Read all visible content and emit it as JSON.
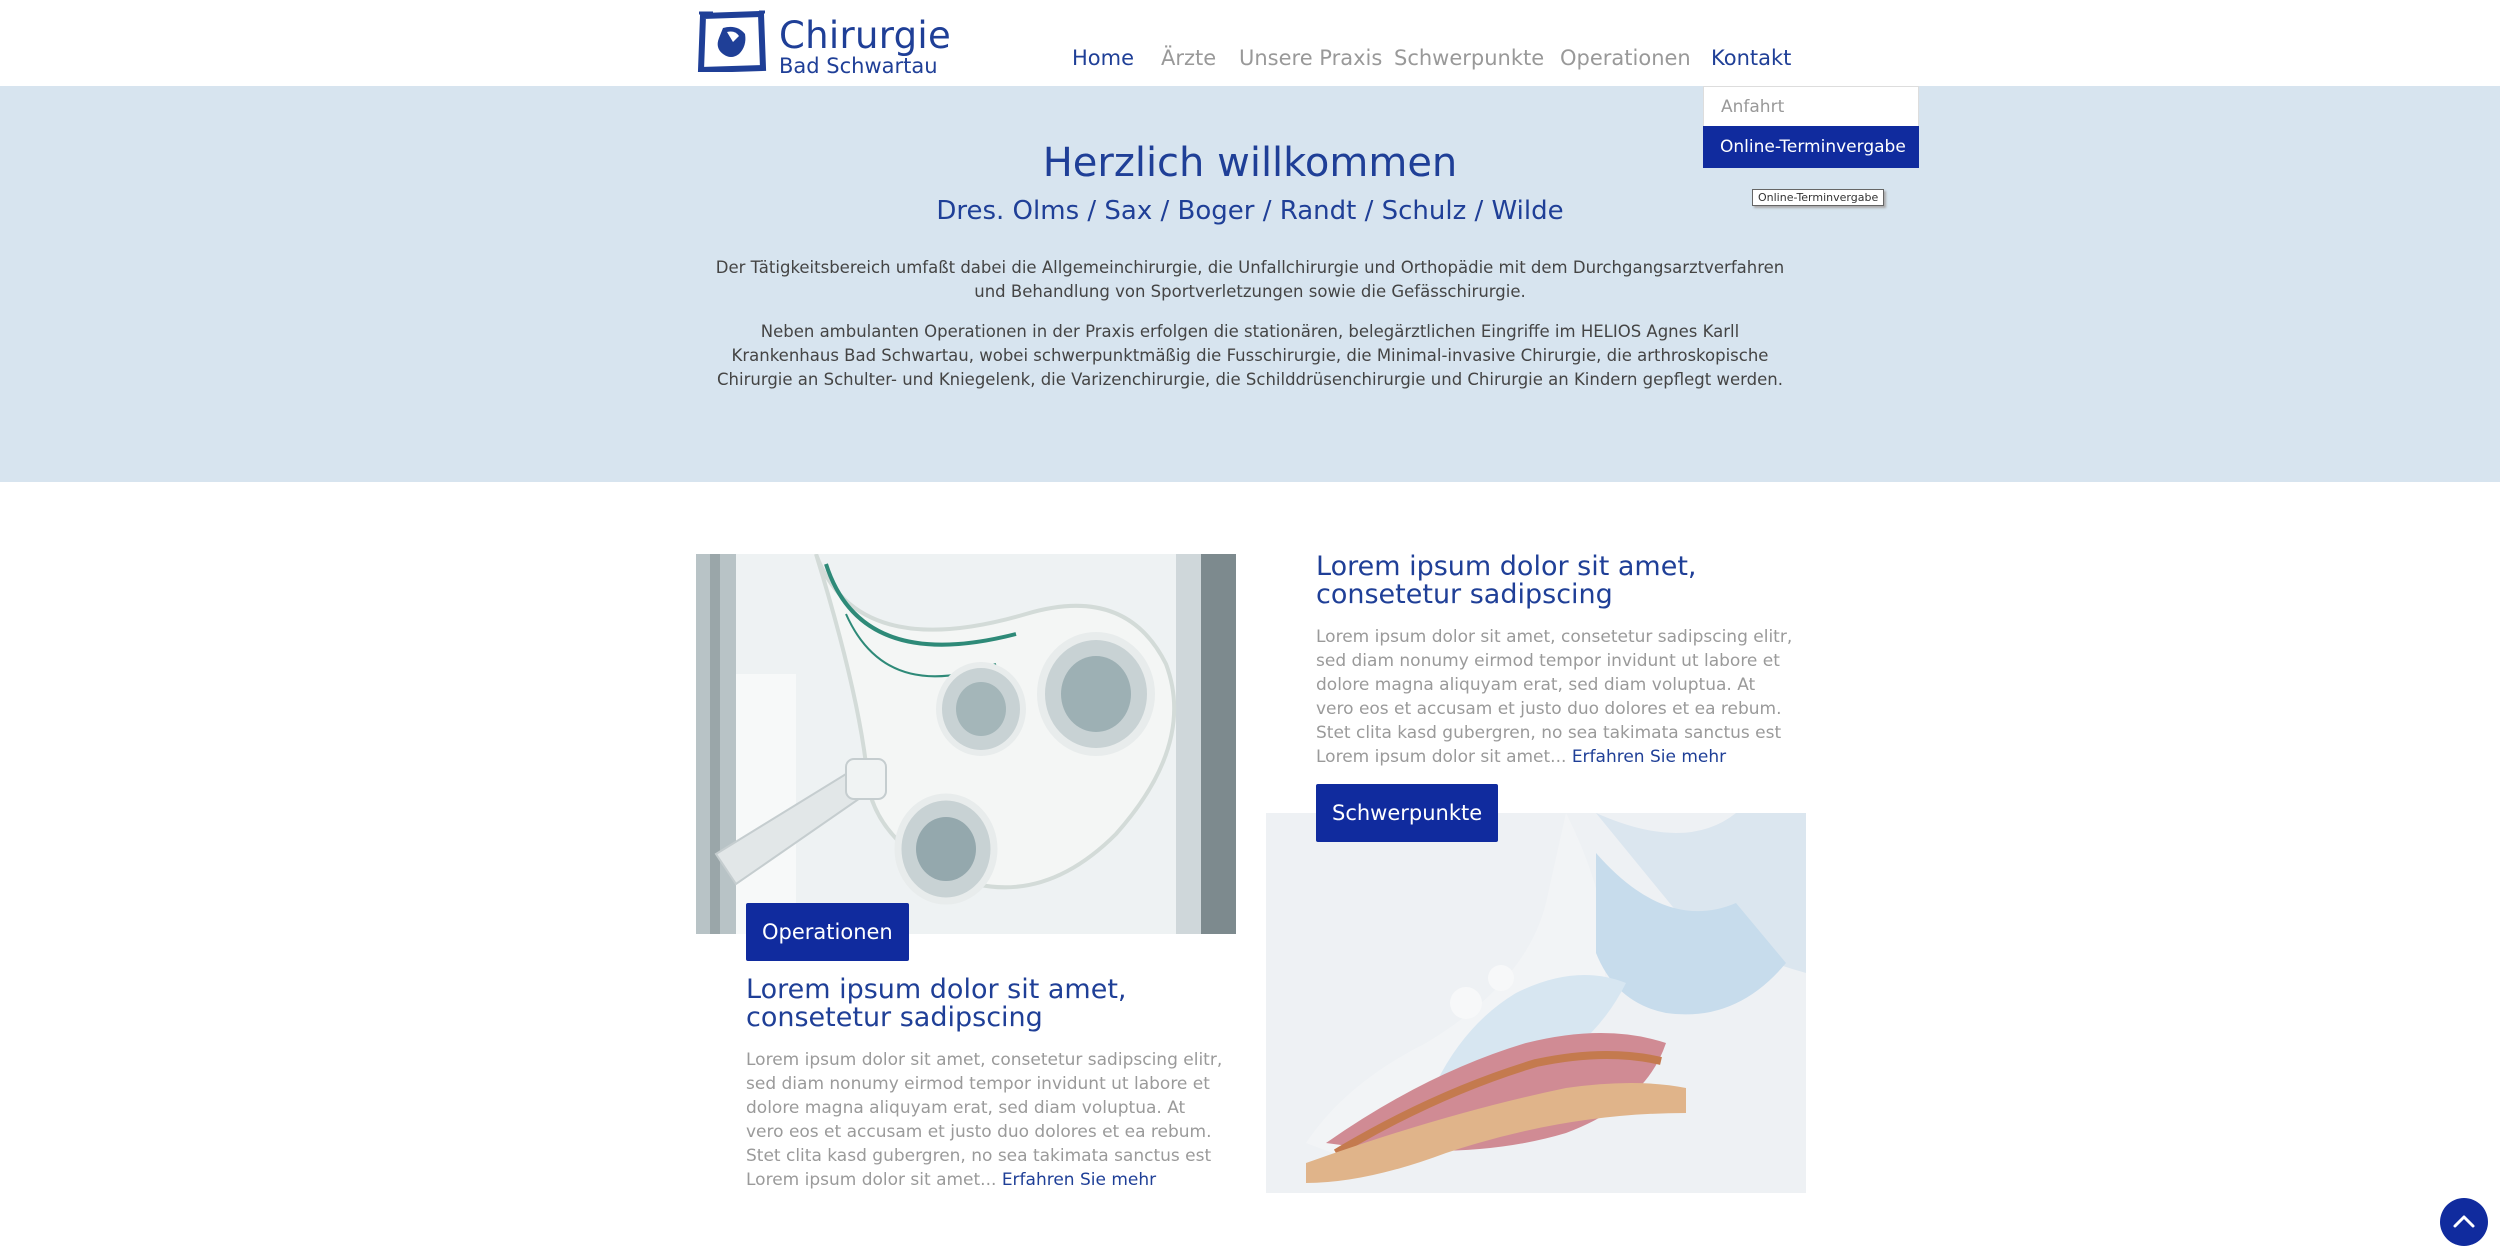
{
  "header": {
    "logo_title": "Chirurgie",
    "logo_subtitle": "Bad Schwartau"
  },
  "nav": {
    "items": [
      {
        "label": "Home",
        "active": true
      },
      {
        "label": "Ärzte"
      },
      {
        "label": "Unsere Praxis"
      },
      {
        "label": "Schwerpunkte"
      },
      {
        "label": "Operationen"
      },
      {
        "label": "Kontakt"
      }
    ],
    "dropdown": {
      "items": [
        "Anfahrt",
        "Online-Terminvergabe"
      ],
      "tooltip": "Online-Terminvergabe"
    }
  },
  "hero": {
    "title": "Herzlich willkommen",
    "subtitle": "Dres. Olms / Sax / Boger / Randt / Schulz / Wilde",
    "p1": "Der Tätigkeitsbereich umfaßt dabei die Allgemeinchirurgie, die Unfallchirurgie und Orthopädie mit dem Durchgangsarztverfahren und Behandlung von Sportverletzungen sowie die Gefässchirurgie.",
    "p2": "Neben ambulanten Operationen in der Praxis erfolgen die stationären, belegärztlichen Eingriffe im HELIOS Agnes Karll Krankenhaus Bad Schwartau, wobei schwerpunktmäßig die Fusschirurgie, die Minimal-invasive Chirurgie, die arthroskopische Chirurgie an Schulter- und Kniegelenk, die Varizenchirurgie, die Schilddrüsenchirurgie und Chirurgie an Kindern gepflegt werden."
  },
  "cards": [
    {
      "tag": "Operationen",
      "title": "Lorem ipsum dolor sit amet, consetetur sadipscing",
      "text": "Lorem ipsum dolor sit amet, consetetur sadipscing elitr, sed diam nonumy eirmod tempor invidunt ut labore et dolore magna aliquyam erat, sed diam voluptua. At vero eos et accusam et justo duo dolores et ea rebum. Stet clita kasd gubergren, no sea takimata sanctus est Lorem ipsum dolor sit amet...",
      "more": "Erfahren Sie mehr"
    },
    {
      "tag": "Schwerpunkte",
      "title": "Lorem ipsum dolor sit amet, consetetur sadipscing",
      "text": "Lorem ipsum dolor sit amet, consetetur sadipscing elitr, sed diam nonumy eirmod tempor invidunt ut labore et dolore magna aliquyam erat, sed diam voluptua. At vero eos et accusam et justo duo dolores et ea rebum. Stet clita kasd gubergren, no sea takimata sanctus est Lorem ipsum dolor sit amet...",
      "more": "Erfahren Sie mehr"
    }
  ],
  "colors": {
    "brand": "#1f3f97",
    "button": "#102b9e",
    "hero_bg": "#d7e4ef"
  },
  "icons": {
    "logo": "logo-square-icon",
    "to_top": "chevron-up-icon"
  }
}
